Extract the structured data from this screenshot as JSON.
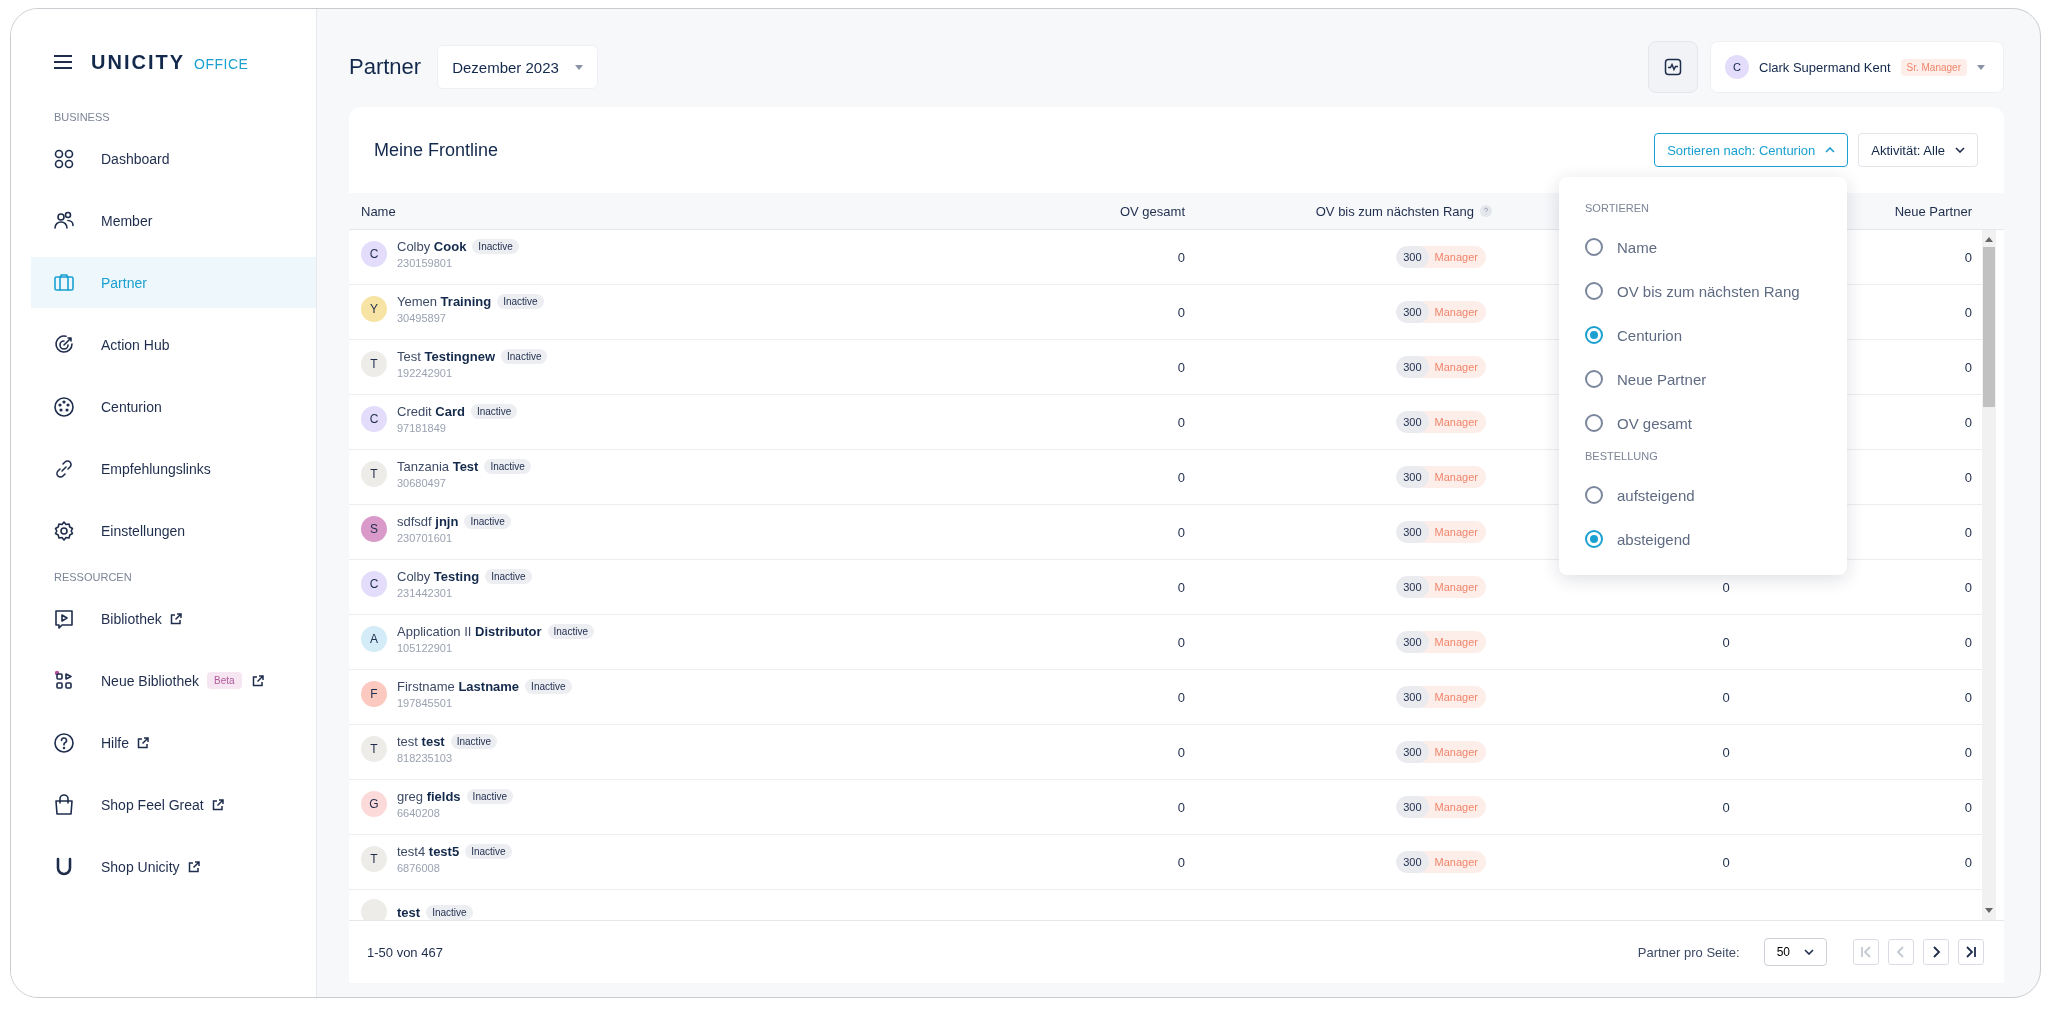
{
  "logo": {
    "brand": "UNICITY",
    "product": "OFFICE"
  },
  "sidebar": {
    "sections": [
      {
        "title": "BUSINESS",
        "items": [
          {
            "label": "Dashboard",
            "selected": false,
            "external": false
          },
          {
            "label": "Member",
            "selected": false,
            "external": false
          },
          {
            "label": "Partner",
            "selected": true,
            "external": false
          },
          {
            "label": "Action Hub",
            "selected": false,
            "external": false
          },
          {
            "label": "Centurion",
            "selected": false,
            "external": false
          },
          {
            "label": "Empfehlungslinks",
            "selected": false,
            "external": false
          },
          {
            "label": "Einstellungen",
            "selected": false,
            "external": false
          }
        ]
      },
      {
        "title": "RESSOURCEN",
        "items": [
          {
            "label": "Bibliothek",
            "selected": false,
            "external": true
          },
          {
            "label": "Neue Bibliothek",
            "badge": "Beta",
            "selected": false,
            "external": true
          },
          {
            "label": "Hilfe",
            "selected": false,
            "external": true
          },
          {
            "label": "Shop Feel Great",
            "selected": false,
            "external": true
          },
          {
            "label": "Shop Unicity",
            "selected": false,
            "external": true
          }
        ]
      }
    ]
  },
  "header": {
    "title": "Partner",
    "period": "Dezember 2023",
    "user": {
      "initial": "C",
      "name": "Clark Supermand Kent",
      "rank": "Sr. Manager"
    }
  },
  "card": {
    "title": "Meine Frontline",
    "sort_button": "Sortieren nach: Centurion",
    "filter_button": "Aktivität: Alle"
  },
  "table": {
    "columns": [
      "Name",
      "OV gesamt",
      "OV bis zum nächsten Rang",
      "",
      "Neue Partner"
    ],
    "rows": [
      {
        "initial": "C",
        "color": "#e3dcfb",
        "name": "Colby **Cook**",
        "status": "Inactive",
        "id": "230159801",
        "ov": "0",
        "next_ov": "300",
        "next_rank": "Manager",
        "new": "0"
      },
      {
        "initial": "Y",
        "color": "#f7e3a3",
        "name": "Yemen **Training**",
        "status": "Inactive",
        "id": "30495897",
        "ov": "0",
        "next_ov": "300",
        "next_rank": "Manager",
        "new": "0"
      },
      {
        "initial": "T",
        "color": "#eeece9",
        "name": "Test **Testingnew**",
        "status": "Inactive",
        "id": "192242901",
        "ov": "0",
        "next_ov": "300",
        "next_rank": "Manager",
        "new": "0"
      },
      {
        "initial": "C",
        "color": "#e3dcfb",
        "name": "Credit **Card**",
        "status": "Inactive",
        "id": "97181849",
        "ov": "0",
        "next_ov": "300",
        "next_rank": "Manager",
        "new": "0"
      },
      {
        "initial": "T",
        "color": "#eeece9",
        "name": "Tanzania **Test**",
        "status": "Inactive",
        "id": "30680497",
        "ov": "0",
        "next_ov": "300",
        "next_rank": "Manager",
        "new": "0"
      },
      {
        "initial": "S",
        "color": "#d99ac9",
        "name": "sdfsdf **jnjn**",
        "status": "Inactive",
        "id": "230701601",
        "ov": "0",
        "next_ov": "300",
        "next_rank": "Manager",
        "new": "0"
      },
      {
        "initial": "C",
        "color": "#e3dcfb",
        "name": "Colby **Testing**",
        "status": "Inactive",
        "id": "231442301",
        "ov": "0",
        "next_ov": "300",
        "next_rank": "Manager",
        "column_4": "0",
        "new": "0"
      },
      {
        "initial": "A",
        "color": "#d3ecf8",
        "name": "Application II **Distributor**",
        "status": "Inactive",
        "id": "105122901",
        "ov": "0",
        "next_ov": "300",
        "next_rank": "Manager",
        "column_4": "0",
        "new": "0"
      },
      {
        "initial": "F",
        "color": "#fcc9c0",
        "name": "Firstname **Lastname**",
        "status": "Inactive",
        "id": "197845501",
        "ov": "0",
        "next_ov": "300",
        "next_rank": "Manager",
        "column_4": "0",
        "new": "0"
      },
      {
        "initial": "T",
        "color": "#eeece9",
        "name": "test **test**",
        "status": "Inactive",
        "id": "818235103",
        "ov": "0",
        "next_ov": "300",
        "next_rank": "Manager",
        "column_4": "0",
        "new": "0"
      },
      {
        "initial": "G",
        "color": "#fcdada",
        "name": "greg **fields**",
        "status": "Inactive",
        "id": "6640208",
        "ov": "0",
        "next_ov": "300",
        "next_rank": "Manager",
        "column_4": "0",
        "new": "0"
      },
      {
        "initial": "T",
        "color": "#eeece9",
        "name": "test4 **test5**",
        "status": "Inactive",
        "id": "6876008",
        "ov": "0",
        "next_ov": "300",
        "next_rank": "Manager",
        "column_4": "0",
        "new": "0"
      },
      {
        "color": "#eeece9",
        "name": "**test**",
        "status": "Inactive"
      }
    ]
  },
  "sort_menu": {
    "groups": [
      {
        "title": "SORTIEREN",
        "options": [
          {
            "label": "Name",
            "selected": false
          },
          {
            "label": "OV bis zum nächsten Rang",
            "selected": false
          },
          {
            "label": "Centurion",
            "selected": true
          },
          {
            "label": "Neue Partner",
            "selected": false
          },
          {
            "label": "OV gesamt",
            "selected": false
          }
        ]
      },
      {
        "title": "BESTELLUNG",
        "options": [
          {
            "label": "aufsteigend",
            "selected": false
          },
          {
            "label": "absteigend",
            "selected": true
          }
        ]
      }
    ]
  },
  "footer": {
    "range": "1-50 von 467",
    "per_page_label": "Partner pro Seite:",
    "per_page": "50",
    "pager": [
      {
        "kind": "first",
        "disabled": true
      },
      {
        "kind": "prev",
        "disabled": true
      },
      {
        "kind": "next",
        "disabled": false
      },
      {
        "kind": "last",
        "disabled": false
      }
    ]
  }
}
